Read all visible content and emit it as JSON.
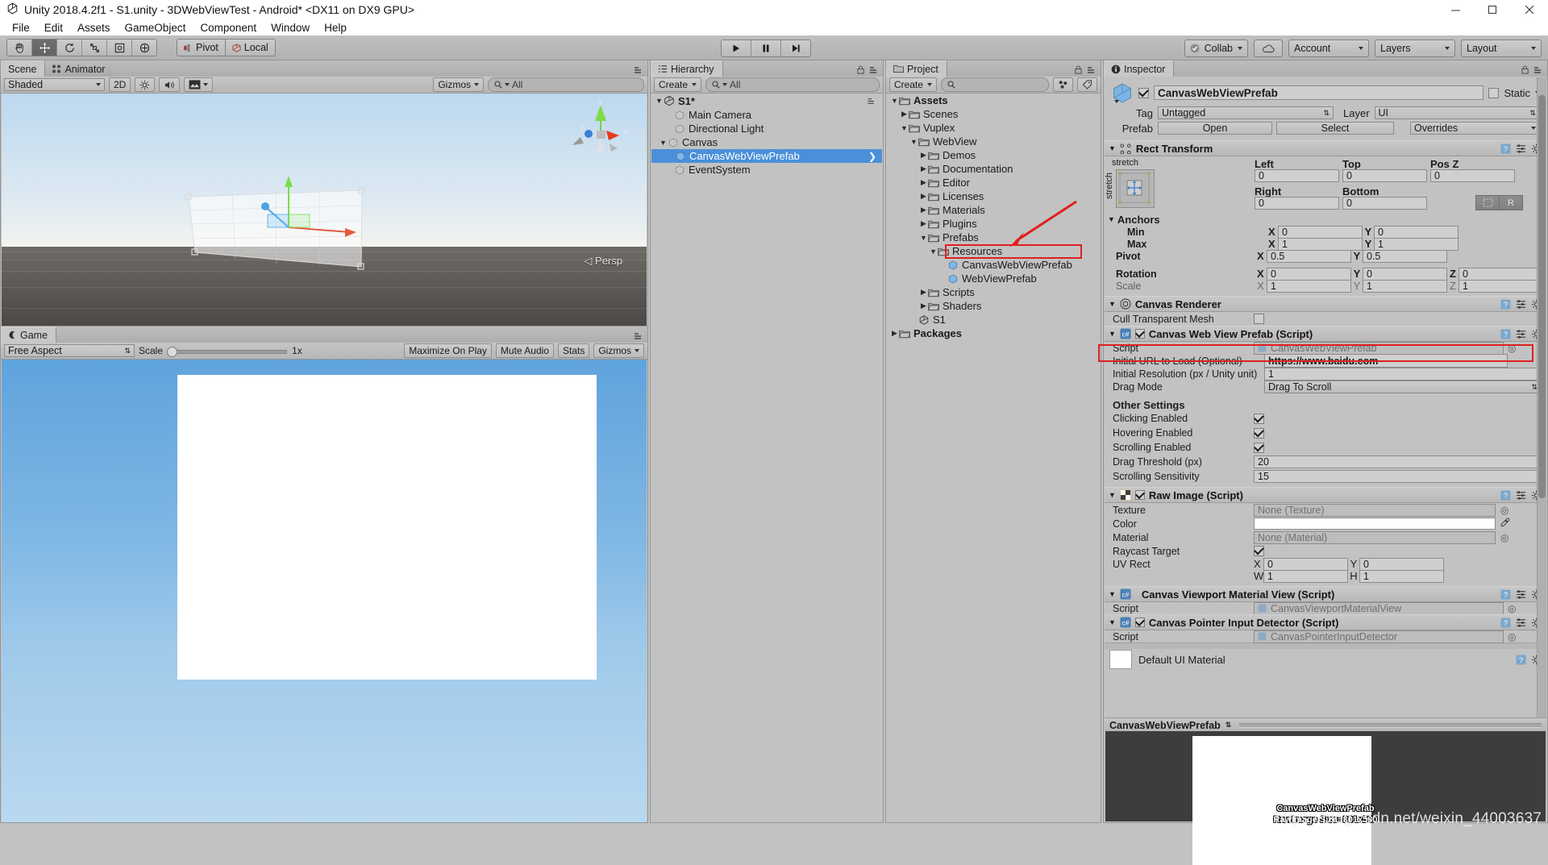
{
  "window": {
    "title": "Unity 2018.4.2f1 - S1.unity - 3DWebViewTest - Android* <DX11 on DX9 GPU>",
    "minimize": "minimize-icon",
    "maximize": "maximize-icon",
    "close": "close-icon"
  },
  "menu": {
    "items": [
      "File",
      "Edit",
      "Assets",
      "GameObject",
      "Component",
      "Window",
      "Help"
    ]
  },
  "toolbar": {
    "tools": [
      "hand-tool",
      "move-tool",
      "rotate-tool",
      "scale-tool",
      "rect-tool",
      "transform-tool"
    ],
    "active_tool_index": 1,
    "pivot_label": "Pivot",
    "local_label": "Local",
    "play_label": "play-button",
    "pause_label": "pause-button",
    "step_label": "step-button",
    "collab_label": "Collab",
    "cloud_label": "cloud-button",
    "account_label": "Account",
    "layers_label": "Layers",
    "layout_label": "Layout"
  },
  "scene": {
    "tabs": [
      {
        "label": "Scene",
        "selected": true
      },
      {
        "label": "Animator",
        "selected": false
      }
    ],
    "draw_mode": "Shaded",
    "two_d": "2D",
    "gizmos_label": "Gizmos",
    "search_placeholder": "All",
    "persp_label": "Persp",
    "axis_labels": [
      "x",
      "y",
      "z"
    ]
  },
  "game": {
    "tab": "Game",
    "aspect": "Free Aspect",
    "scale_label": "Scale",
    "scale_value": "1x",
    "maximize_on_play": "Maximize On Play",
    "mute_audio": "Mute Audio",
    "stats": "Stats",
    "gizmos": "Gizmos"
  },
  "hierarchy": {
    "tab": "Hierarchy",
    "create_label": "Create",
    "search_placeholder": "All",
    "scene_name": "S1*",
    "items": [
      {
        "label": "Main Camera",
        "depth": 1,
        "expandable": false,
        "selected": false
      },
      {
        "label": "Directional Light",
        "depth": 1,
        "expandable": false,
        "selected": false
      },
      {
        "label": "Canvas",
        "depth": 1,
        "expandable": true,
        "expanded": true,
        "selected": false
      },
      {
        "label": "CanvasWebViewPrefab",
        "depth": 2,
        "expandable": false,
        "selected": true,
        "prefab": true
      },
      {
        "label": "EventSystem",
        "depth": 1,
        "expandable": false,
        "selected": false
      }
    ]
  },
  "project": {
    "tab": "Project",
    "create_label": "Create",
    "search_placeholder": "",
    "items": [
      {
        "label": "Assets",
        "depth": 0,
        "icon": "folder",
        "expandable": true,
        "expanded": true,
        "bold": true
      },
      {
        "label": "Scenes",
        "depth": 1,
        "icon": "folder",
        "expandable": true,
        "expanded": false
      },
      {
        "label": "Vuplex",
        "depth": 1,
        "icon": "folder",
        "expandable": true,
        "expanded": true
      },
      {
        "label": "WebView",
        "depth": 2,
        "icon": "folder",
        "expandable": true,
        "expanded": true
      },
      {
        "label": "Demos",
        "depth": 3,
        "icon": "folder",
        "expandable": true,
        "expanded": false
      },
      {
        "label": "Documentation",
        "depth": 3,
        "icon": "folder",
        "expandable": true,
        "expanded": false
      },
      {
        "label": "Editor",
        "depth": 3,
        "icon": "folder",
        "expandable": true,
        "expanded": false
      },
      {
        "label": "Licenses",
        "depth": 3,
        "icon": "folder",
        "expandable": true,
        "expanded": false
      },
      {
        "label": "Materials",
        "depth": 3,
        "icon": "folder",
        "expandable": true,
        "expanded": false
      },
      {
        "label": "Plugins",
        "depth": 3,
        "icon": "folder",
        "expandable": true,
        "expanded": false
      },
      {
        "label": "Prefabs",
        "depth": 3,
        "icon": "folder",
        "expandable": true,
        "expanded": true
      },
      {
        "label": "Resources",
        "depth": 4,
        "icon": "folder",
        "expandable": true,
        "expanded": true
      },
      {
        "label": "CanvasWebViewPrefab",
        "depth": 5,
        "icon": "prefab",
        "expandable": false,
        "highlighted": true
      },
      {
        "label": "WebViewPrefab",
        "depth": 5,
        "icon": "prefab",
        "expandable": false
      },
      {
        "label": "Scripts",
        "depth": 3,
        "icon": "folder",
        "expandable": true,
        "expanded": false
      },
      {
        "label": "Shaders",
        "depth": 3,
        "icon": "folder",
        "expandable": true,
        "expanded": false
      },
      {
        "label": "S1",
        "depth": 2,
        "icon": "unity",
        "expandable": false
      },
      {
        "label": "Packages",
        "depth": 0,
        "icon": "folder",
        "expandable": true,
        "expanded": false,
        "bold": true
      }
    ]
  },
  "inspector": {
    "tab": "Inspector",
    "object_name": "CanvasWebViewPrefab",
    "object_enabled": true,
    "static_label": "Static",
    "static_checked": false,
    "tag_label": "Tag",
    "tag_value": "Untagged",
    "layer_label": "Layer",
    "layer_value": "UI",
    "prefab_label": "Prefab",
    "prefab_open": "Open",
    "prefab_select": "Select",
    "prefab_overrides": "Overrides",
    "rect_transform": {
      "title": "Rect Transform",
      "anchor_preset": "stretch",
      "anchor_preset_vertical": "stretch",
      "left_label": "Left",
      "left_value": "0",
      "top_label": "Top",
      "top_value": "0",
      "posz_label": "Pos Z",
      "posz_value": "0",
      "right_label": "Right",
      "right_value": "0",
      "bottom_label": "Bottom",
      "bottom_value": "0",
      "blueprint_label": "R",
      "anchors_label": "Anchors",
      "min_label": "Min",
      "min_x": "0",
      "min_y": "0",
      "max_label": "Max",
      "max_x": "1",
      "max_y": "1",
      "pivot_label": "Pivot",
      "pivot_x": "0.5",
      "pivot_y": "0.5",
      "rotation_label": "Rotation",
      "rot_x": "0",
      "rot_y": "0",
      "rot_z": "0",
      "scale_label": "Scale",
      "scale_x": "1",
      "scale_y": "1",
      "scale_z": "1",
      "axis_x": "X",
      "axis_y": "Y",
      "axis_z": "Z",
      "axis_w": "W",
      "axis_h": "H"
    },
    "canvas_renderer": {
      "title": "Canvas Renderer",
      "cull_label": "Cull Transparent Mesh",
      "cull_checked": false
    },
    "canvas_webview_prefab": {
      "title": "Canvas Web View Prefab (Script)",
      "enabled": true,
      "script_label": "Script",
      "script_value": "CanvasWebViewPrefab",
      "url_label": "Initial URL to Load (Optional)",
      "url_value": "https://www.baidu.com",
      "resolution_label": "Initial Resolution (px / Unity unit)",
      "resolution_value": "1",
      "drag_mode_label": "Drag Mode",
      "drag_mode_value": "Drag To Scroll",
      "other_settings_label": "Other Settings",
      "clicking_label": "Clicking Enabled",
      "clicking_checked": true,
      "hovering_label": "Hovering Enabled",
      "hovering_checked": true,
      "scrolling_label": "Scrolling Enabled",
      "scrolling_checked": true,
      "drag_threshold_label": "Drag Threshold (px)",
      "drag_threshold_value": "20",
      "scroll_sensitivity_label": "Scrolling Sensitivity",
      "scroll_sensitivity_value": "15"
    },
    "raw_image": {
      "title": "Raw Image (Script)",
      "enabled": true,
      "texture_label": "Texture",
      "texture_value": "None (Texture)",
      "color_label": "Color",
      "color_value": "#FFFFFF",
      "material_label": "Material",
      "material_value": "None (Material)",
      "raycast_label": "Raycast Target",
      "raycast_checked": true,
      "uv_label": "UV Rect",
      "uv_x": "0",
      "uv_y": "0",
      "uv_w": "1",
      "uv_h": "1"
    },
    "canvas_viewport_material_view": {
      "title": "Canvas Viewport Material View (Script)",
      "script_label": "Script",
      "script_value": "CanvasViewportMaterialView"
    },
    "canvas_pointer_input_detector": {
      "title": "Canvas Pointer Input Detector (Script)",
      "enabled": true,
      "script_label": "Script",
      "script_value": "CanvasPointerInputDetector"
    },
    "material": {
      "title": "Default UI Material"
    },
    "preview": {
      "title": "CanvasWebViewPrefab",
      "line1": "CanvasWebViewPrefab",
      "line2": "RawImage Size: 801x580"
    }
  },
  "watermark": "https://blog.csdn.net/weixin_44003637",
  "colors": {
    "accent_selection": "#4a90d9",
    "highlight_red": "#e02020",
    "panel_bg": "#c2c2c2",
    "header_bg": "#c8c8c8"
  }
}
